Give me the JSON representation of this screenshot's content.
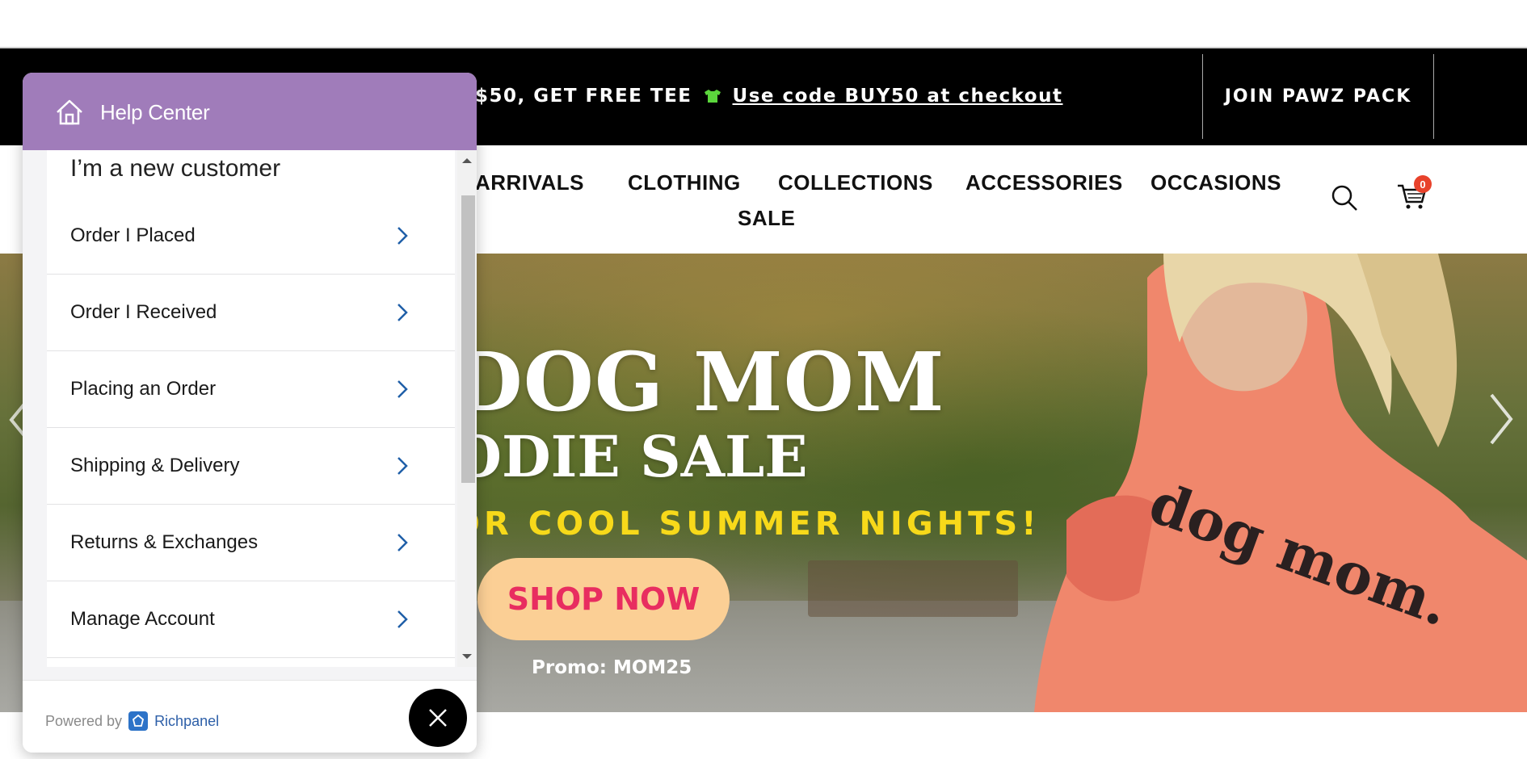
{
  "announcement": {
    "text": "$50, GET FREE TEE",
    "code_text": "Use code BUY50 at checkout",
    "join_label": "JOIN PAWZ PACK"
  },
  "nav": {
    "items": [
      {
        "label": "ARRIVALS"
      },
      {
        "label": "CLOTHING"
      },
      {
        "label": "COLLECTIONS"
      },
      {
        "label": "ACCESSORIES"
      },
      {
        "label": "OCCASIONS"
      },
      {
        "label": "SALE"
      }
    ],
    "cart_count": "0"
  },
  "hero": {
    "title_line1": "DOG MOM",
    "title_line2": "ODIE SALE",
    "subtitle": "OR COOL SUMMER NIGHTS!",
    "button_label": "SHOP NOW",
    "promo": "Promo: MOM25",
    "shirt_text": "dog mom."
  },
  "widget": {
    "header_title": "Help Center",
    "section_heading": "I’m a new customer",
    "menu_items": [
      {
        "label": "Order I Placed"
      },
      {
        "label": "Order I Received"
      },
      {
        "label": "Placing an Order"
      },
      {
        "label": "Shipping & Delivery"
      },
      {
        "label": "Returns & Exchanges"
      },
      {
        "label": "Manage Account"
      }
    ],
    "powered_by": "Powered by",
    "brand": "Richpanel"
  },
  "colors": {
    "widget_header": "#a07cba",
    "announcement_bg": "#000000",
    "shop_button_bg": "#fbcf95",
    "shop_button_text": "#e82d60",
    "hero_subtitle": "#f7d91a",
    "cart_badge": "#e8422b",
    "chevron": "#1f5fa8"
  }
}
